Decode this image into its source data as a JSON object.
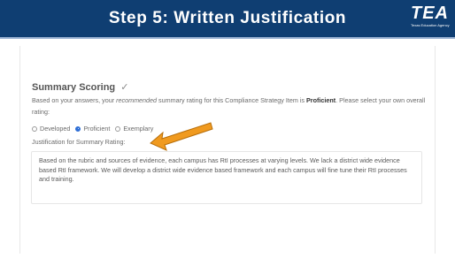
{
  "banner": {
    "title": "Step 5: Written Justification",
    "logo": {
      "word": "TEA",
      "subtitle": "Texas Education Agency"
    }
  },
  "summary": {
    "title": "Summary Scoring",
    "check": "✓",
    "intro_prefix": "Based on your answers, your ",
    "intro_em": "recommended",
    "intro_mid": " summary rating for this Compliance Strategy Item is ",
    "intro_bold": "Proficient",
    "intro_suffix": ". Please select your own overall rating:",
    "options": [
      {
        "label": "Developed",
        "selected": false
      },
      {
        "label": "Proficient",
        "selected": true
      },
      {
        "label": "Exemplary",
        "selected": false
      }
    ],
    "justification_label": "Justification for Summary Rating:",
    "justification_text": "Based on the rubric and sources of evidence, each campus has RtI processes at varying levels.  We lack a district wide evidence based RtI framework.  We will develop a district wide evidence based framework and each campus will fine tune their RtI processes and training."
  },
  "colors": {
    "banner": "#0f3e72",
    "arrow": "#f09a1f",
    "radio_selected": "#2f6fd6"
  },
  "icons": [
    "checkmark-icon",
    "tea-logo",
    "arrow-pointer-icon"
  ]
}
